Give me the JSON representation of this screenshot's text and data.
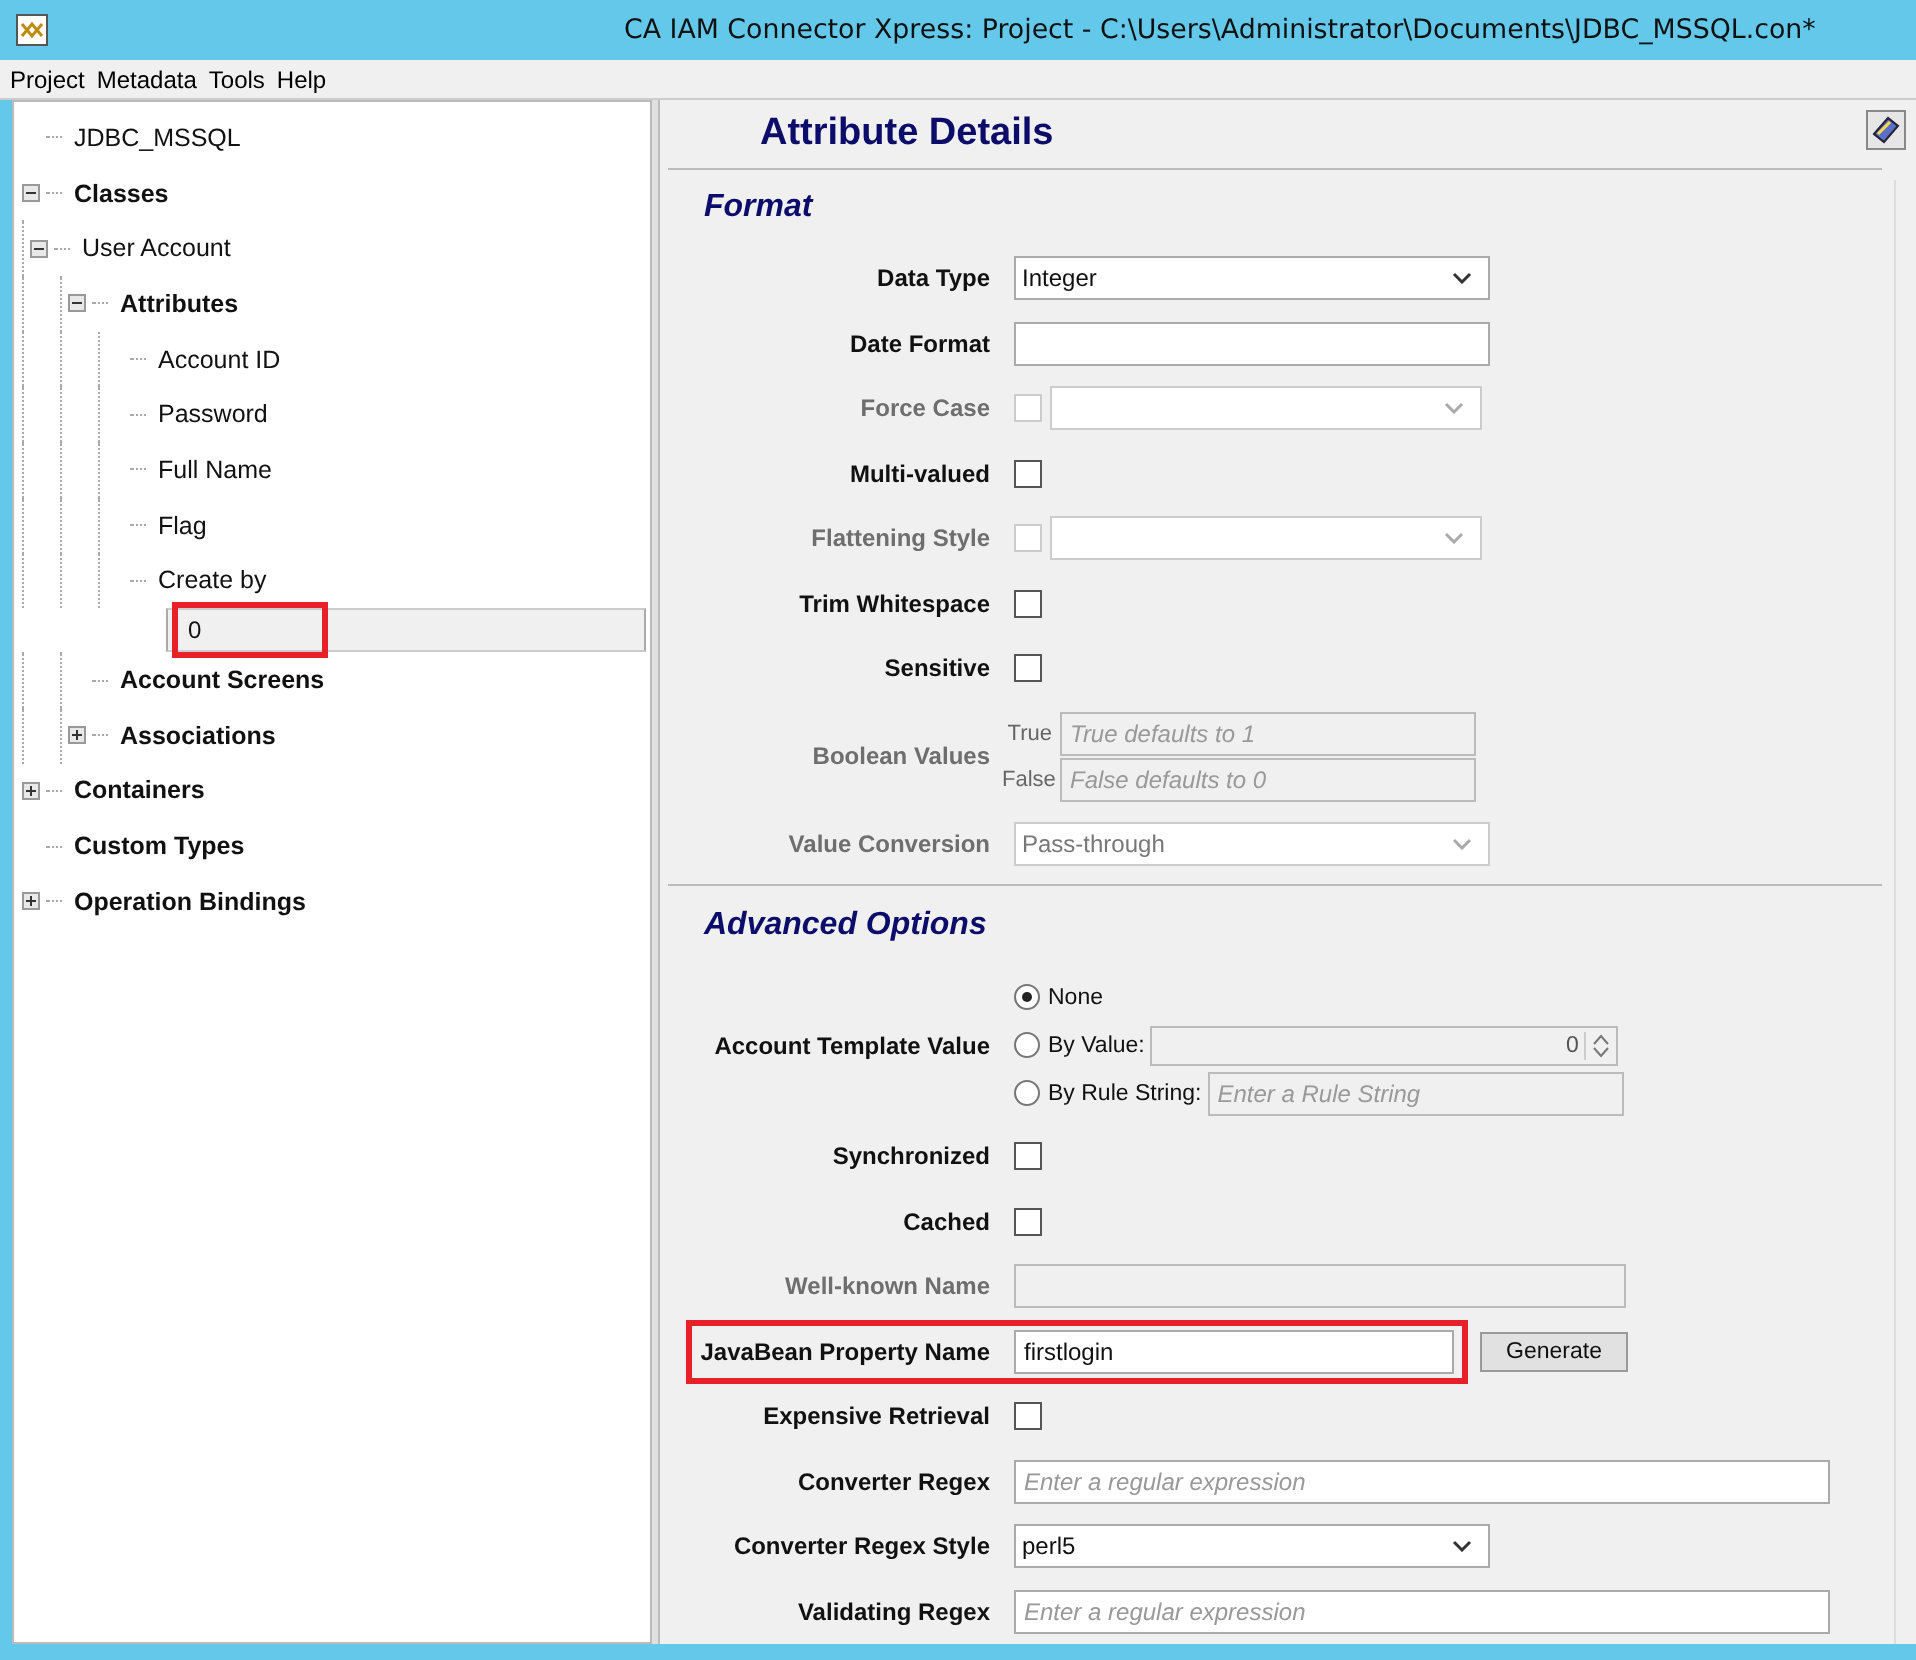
{
  "window": {
    "title": "CA IAM Connector Xpress: Project - C:\\Users\\Administrator\\Documents\\JDBC_MSSQL.con*"
  },
  "menu": [
    "Project",
    "Metadata",
    "Tools",
    "Help"
  ],
  "tree": [
    {
      "label": "JDBC_MSSQL",
      "bold": false,
      "selected": false
    },
    {
      "label": "Classes",
      "bold": true,
      "selected": false,
      "expanded": true,
      "children": [
        {
          "label": "User Account",
          "bold": false,
          "selected": false,
          "expanded": true,
          "children": [
            {
              "label": "Attributes",
              "bold": true,
              "selected": false,
              "expanded": true,
              "children": [
                {
                  "label": "Account ID",
                  "bold": false,
                  "selected": false
                },
                {
                  "label": "Password",
                  "bold": false,
                  "selected": false
                },
                {
                  "label": "Full Name",
                  "bold": false,
                  "selected": false
                },
                {
                  "label": "Flag",
                  "bold": false,
                  "selected": false
                },
                {
                  "label": "Create by",
                  "bold": false,
                  "selected": false
                },
                {
                  "label": "0",
                  "bold": false,
                  "selected": true,
                  "highlighted": true
                }
              ]
            },
            {
              "label": "Account Screens",
              "bold": true,
              "selected": false
            },
            {
              "label": "Associations",
              "bold": true,
              "selected": false,
              "expanded": false
            }
          ]
        }
      ]
    },
    {
      "label": "Containers",
      "bold": true,
      "selected": false,
      "expanded": false
    },
    {
      "label": "Custom Types",
      "bold": true,
      "selected": false
    },
    {
      "label": "Operation Bindings",
      "bold": true,
      "selected": false,
      "expanded": false
    }
  ],
  "panel": {
    "title": "Attribute Details",
    "sections": [
      {
        "title": "Format",
        "rows": [
          {
            "label": "Data Type",
            "kind": "select",
            "disabled": false,
            "value": "Integer"
          },
          {
            "label": "Date Format",
            "kind": "text",
            "disabled": false
          },
          {
            "label": "Force Case",
            "kind": "check_select",
            "disabled": true,
            "checked": false
          },
          {
            "label": "Multi-valued",
            "kind": "checkbox",
            "disabled": false,
            "checked": false
          },
          {
            "label": "Flattening Style",
            "kind": "check_select",
            "disabled": true,
            "checked": false
          },
          {
            "label": "Trim Whitespace",
            "kind": "checkbox",
            "disabled": false,
            "checked": false
          },
          {
            "label": "Sensitive",
            "kind": "checkbox",
            "disabled": false,
            "checked": false
          },
          {
            "label": "Boolean Values",
            "kind": "pair",
            "disabled": true,
            "entries": [
              {
                "label": "True",
                "placeholder": "True defaults to 1"
              },
              {
                "label": "False",
                "placeholder": "False defaults to 0"
              }
            ]
          },
          {
            "label": "Value Conversion",
            "kind": "select",
            "disabled": true,
            "value": "Pass-through"
          }
        ]
      },
      {
        "title": "Advanced Options",
        "rows": [
          {
            "label": "Account Template Value",
            "kind": "radios",
            "disabled": false,
            "options": [
              {
                "label": "None",
                "selected": true
              },
              {
                "label": "By Value:",
                "selected": false,
                "field": {
                  "kind": "spinner",
                  "value": "0"
                }
              },
              {
                "label": "By Rule String:",
                "selected": false,
                "field": {
                  "kind": "text",
                  "placeholder": "Enter a Rule String"
                }
              }
            ]
          },
          {
            "label": "Synchronized",
            "kind": "checkbox",
            "disabled": false,
            "checked": false
          },
          {
            "label": "Cached",
            "kind": "checkbox",
            "disabled": false,
            "checked": false
          },
          {
            "label": "Well-known Name",
            "kind": "long_text",
            "disabled": true
          },
          {
            "label": "JavaBean Property Name",
            "kind": "text_button",
            "disabled": false,
            "value": "firstlogin",
            "button": "Generate",
            "highlighted": true
          },
          {
            "label": "Expensive Retrieval",
            "kind": "checkbox",
            "disabled": false,
            "checked": false
          },
          {
            "label": "Converter Regex",
            "kind": "regex",
            "disabled": false,
            "placeholder": "Enter a regular expression"
          },
          {
            "label": "Converter Regex Style",
            "kind": "select",
            "disabled": false,
            "value": "perl5"
          },
          {
            "label": "Validating Regex",
            "kind": "regex",
            "disabled": false,
            "placeholder": "Enter a regular expression"
          }
        ]
      }
    ]
  }
}
